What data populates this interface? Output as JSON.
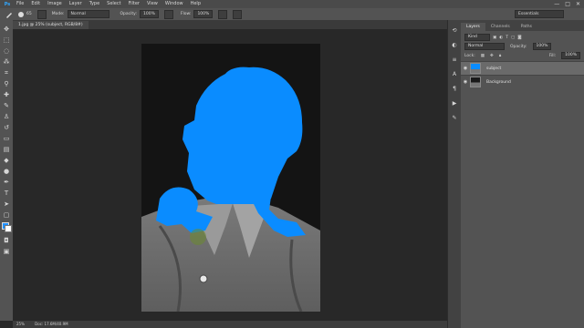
{
  "app": {
    "logo": "Ps"
  },
  "menu": [
    "File",
    "Edit",
    "Image",
    "Layer",
    "Type",
    "Select",
    "Filter",
    "View",
    "Window",
    "Help"
  ],
  "window_controls": [
    "—",
    "□",
    "✕"
  ],
  "options": {
    "brush_size": "65",
    "mode_label": "Mode:",
    "mode_value": "Normal",
    "opacity_label": "Opacity:",
    "opacity_value": "100%",
    "flow_label": "Flow:",
    "flow_value": "100%",
    "workspace": "Essentials"
  },
  "document": {
    "tab_title": "1.jpg @ 25% (subject, RGB/8#)"
  },
  "status": {
    "zoom": "25%",
    "doc": "Doc: 17.6M/40.9M"
  },
  "panel": {
    "tabs": [
      "Layers",
      "Channels",
      "Paths"
    ],
    "kind_label": "Kind",
    "blend_mode": "Normal",
    "opacity_label": "Opacity:",
    "opacity_value": "100%",
    "lock_label": "Lock:",
    "fill_label": "Fill:",
    "fill_value": "100%",
    "layers": [
      {
        "name": "subject",
        "selected": true
      },
      {
        "name": "Background",
        "selected": false
      }
    ]
  },
  "colors": {
    "foreground": "#1e90ff",
    "background": "#ffffff",
    "mask": "#0a8cff"
  }
}
